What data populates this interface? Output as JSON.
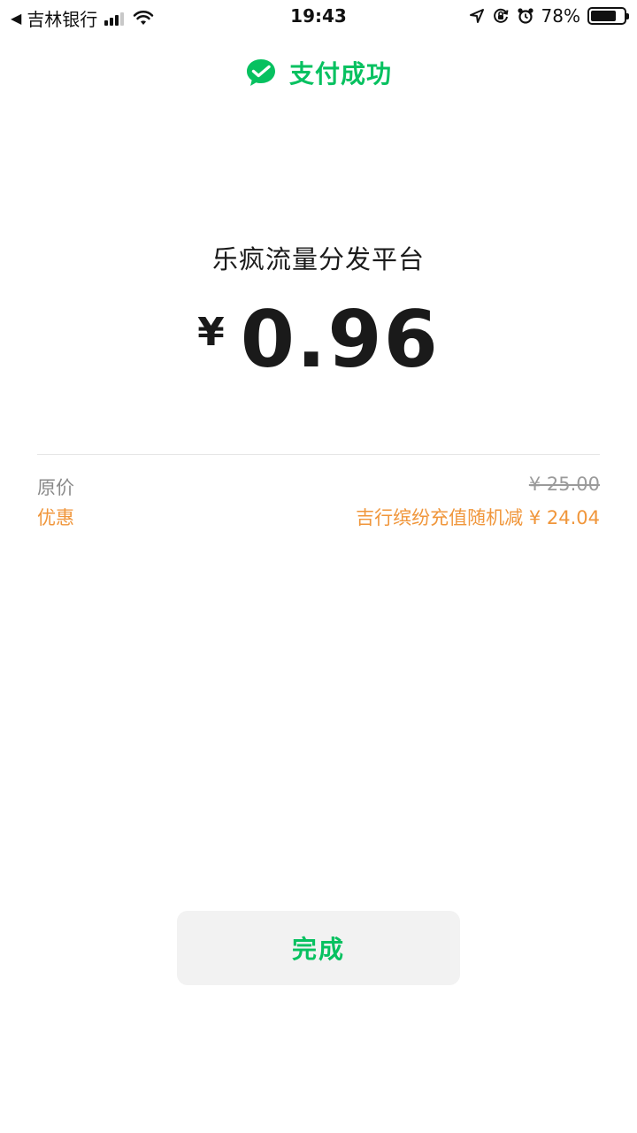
{
  "status_bar": {
    "back_indicator": "◀",
    "carrier": "吉林银行",
    "time": "19:43",
    "battery_text": "78%",
    "battery_level": 0.78,
    "icons": [
      "back-arrow-icon",
      "signal-icon",
      "wifi-icon",
      "location-arrow-icon",
      "rotation-lock-icon",
      "alarm-icon",
      "battery-icon"
    ]
  },
  "header": {
    "icon": "wechat-pay-check-icon",
    "status_text": "支付成功",
    "accent_color": "#07c160"
  },
  "payment": {
    "merchant": "乐疯流量分发平台",
    "currency_symbol": "¥",
    "amount": "0.96"
  },
  "details": {
    "original_price_label": "原价",
    "original_price_value": "¥ 25.00",
    "discount_label": "优惠",
    "discount_value": "吉行缤纷充值随机减 ¥ 24.04",
    "discount_color": "#f0963b"
  },
  "actions": {
    "done_label": "完成"
  }
}
